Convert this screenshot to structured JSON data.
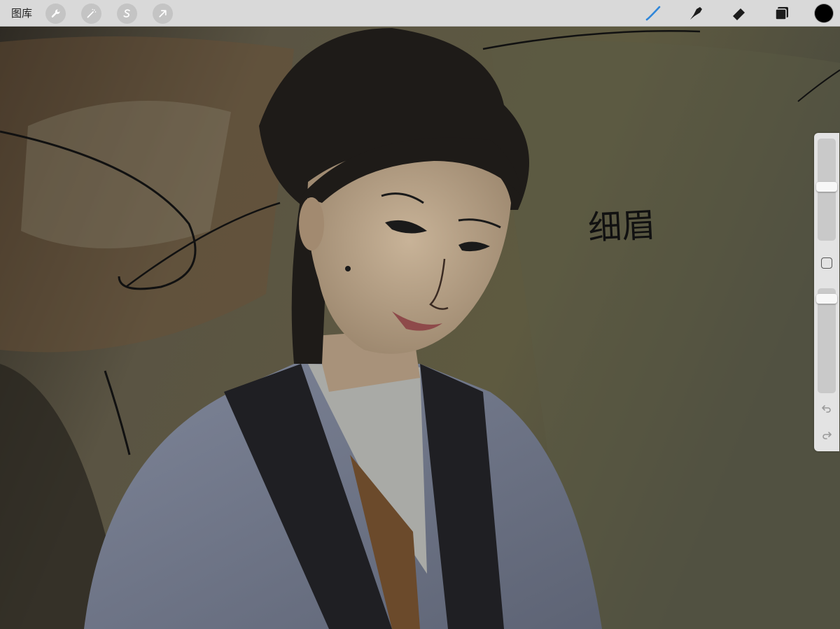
{
  "toolbar": {
    "gallery_label": "图库",
    "left_tools": [
      "wrench-icon",
      "magic-wand-icon",
      "selection-s-icon",
      "transform-arrow-icon"
    ],
    "right_tools": [
      "brush-icon",
      "smudge-icon",
      "eraser-icon",
      "layers-icon"
    ],
    "active_tool": "brush",
    "active_color": "#000000"
  },
  "canvas": {
    "handwritten_note": "细眉",
    "colors": {
      "background": "#4a4536",
      "robe": "#6f7689",
      "skin": "#b49e84",
      "hair": "#1e1b18",
      "inner_robe": "#a9aaa6",
      "under_robe": "#6b4a2b"
    }
  },
  "sidebar": {
    "brush_size_level": 0.47,
    "opacity_level": 0.06
  },
  "colors": {
    "toolbar_bg": "#d9d9d9",
    "active_tool_blue": "#2f86d9",
    "sidebar_bg": "#e3e3e3"
  }
}
